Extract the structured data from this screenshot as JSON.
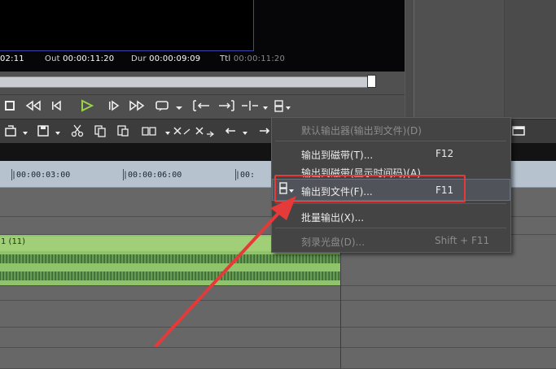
{
  "player": {
    "timecodes": {
      "in_val": "02:11",
      "out_label": "Out",
      "out_val": "00:00:11:20",
      "dur_label": "Dur",
      "dur_val": "00:00:09:09",
      "ttl_label": "Ttl",
      "ttl_val": "00:00:11:20"
    },
    "transport_icons": [
      "stop-icon",
      "rewind-icon",
      "step-back-icon",
      "play-icon",
      "step-forward-icon",
      "fast-forward-icon",
      "loop-icon",
      "mark-in-icon",
      "mark-out-icon",
      "split-icon",
      "output-icon"
    ]
  },
  "timeline": {
    "ruler_labels": [
      "|00:00:03:00",
      "|00:00:06:00",
      "|00:"
    ],
    "clip_label": "1 (11)"
  },
  "menu": {
    "items": [
      {
        "label": "默认输出器(输出到文件)(D)",
        "shortcut": "",
        "disabled": true
      },
      {
        "label": "输出到磁带(T)...",
        "shortcut": "F12",
        "disabled": false
      },
      {
        "label": "输出到磁带(显示时间码)(A)",
        "shortcut": "",
        "disabled": false
      },
      {
        "label": "输出到文件(F)...",
        "shortcut": "F11",
        "disabled": false,
        "highlighted": true
      },
      {
        "label": "批量输出(X)...",
        "shortcut": "",
        "disabled": false
      },
      {
        "label": "刻录光盘(D)...",
        "shortcut": "Shift + F11",
        "disabled": true
      }
    ]
  },
  "colors": {
    "annotation": "#e53a3a",
    "clip": "#8fc46b"
  }
}
